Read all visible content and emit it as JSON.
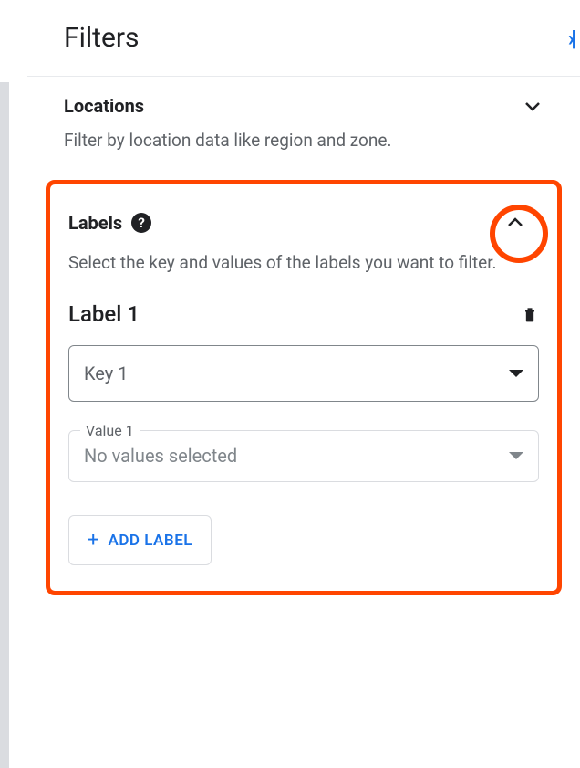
{
  "header": {
    "title": "Filters"
  },
  "locations": {
    "title": "Locations",
    "description": "Filter by location data like region and zone."
  },
  "labels": {
    "title": "Labels",
    "description": "Select the key and values of the labels you want to filter.",
    "item_name": "Label 1",
    "key_select": "Key 1",
    "value_legend": "Value 1",
    "value_placeholder": "No values selected",
    "add_button": "ADD LABEL"
  }
}
